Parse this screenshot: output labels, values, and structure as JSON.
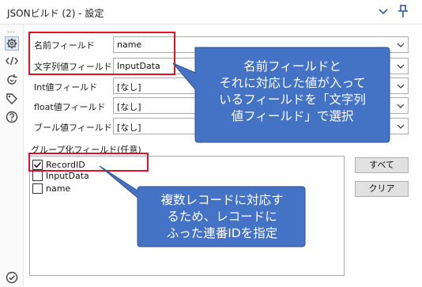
{
  "window": {
    "title": "JSONビルド (2) - 設定"
  },
  "sidebar": {
    "dots": "…",
    "icons": [
      "gear-icon",
      "code-icon",
      "refresh-icon",
      "tag-icon",
      "help-icon"
    ],
    "bottom_icon": "check-circle-icon"
  },
  "fields": {
    "name_field": {
      "label": "名前フィールド",
      "value": "name"
    },
    "string_field": {
      "label": "文字列値フィールド",
      "value": "InputData"
    },
    "int_field": {
      "label": "Int値フィールド",
      "value": "[なし]"
    },
    "float_field": {
      "label": "float値フィールド",
      "value": "[なし]"
    },
    "bool_field": {
      "label": "ブール値フィールド",
      "value": "[なし]"
    }
  },
  "group": {
    "label": "グループ化フィールド(任意)",
    "items": [
      {
        "label": "RecordID",
        "checked": true
      },
      {
        "label": "InputData",
        "checked": false
      },
      {
        "label": "name",
        "checked": false
      }
    ],
    "select_all_button": "すべて",
    "clear_button": "クリア"
  },
  "callouts": {
    "top": {
      "line1": "名前フィールドと",
      "line2": "それに対応した値が入って",
      "line3": "いるフィールドを「文字列",
      "line4": "値フィールド」で選択"
    },
    "bottom": {
      "line1": "複数レコードに対応す",
      "line2": "るため、レコードに",
      "line3": "ふった連番IDを指定"
    }
  },
  "colors": {
    "callout_fill": "#4472c4",
    "callout_border": "#2f528f",
    "highlight_red": "#e3102a"
  }
}
